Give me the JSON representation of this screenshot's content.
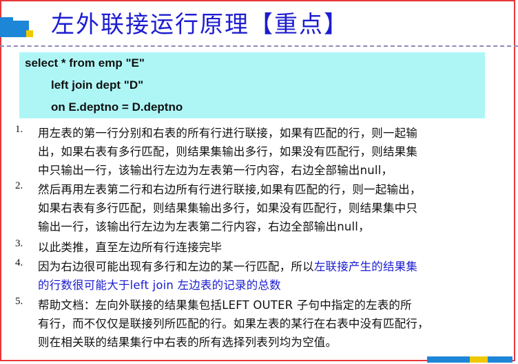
{
  "title": "左外联接运行原理【重点】",
  "code": [
    "select * from emp \"E\"",
    "left join dept \"D\"",
    "on E.deptno = D.deptno"
  ],
  "items": [
    {
      "num": "1.",
      "lines": [
        "用左表的第一行分别和右表的所有行进行联接，如果有匹配的行，则一起输",
        "出，如果右表有多行匹配，则结果集输出多行，如果没有匹配行，则结果集",
        "中只输出一行，该输出行左边为左表第一行内容，右边全部输出null，"
      ]
    },
    {
      "num": "2.",
      "lines": [
        "然后再用左表第二行和右边所有行进行联接,如果有匹配的行，则一起输出，",
        "如果右表有多行匹配，则结果集输出多行，如果没有匹配行，则结果集中只",
        "输出一行，该输出行左边为左表第二行内容，右边全部输出null，"
      ]
    },
    {
      "num": "3.",
      "lines": [
        "以此类推，直至左边所有行连接完毕"
      ]
    },
    {
      "num": "4.",
      "line1_black": "因为右边很可能出现有多行和左边的某一行匹配，所以",
      "line1_blue": "左联接产生的结果集",
      "line2_blue": "的行数很可能大于left join 左边表的记录的总数"
    },
    {
      "num": "5.",
      "lines": [
        "帮助文档：左向外联接的结果集包括LEFT OUTER 子句中指定的左表的所",
        "有行，而不仅仅是联接列所匹配的行。如果左表的某行在右表中没有匹配行，",
        "则在相关联的结果集行中右表的所有选择列表列均为空值。"
      ]
    }
  ],
  "colors": {
    "title": "#1c1cd0",
    "code_background": "#aef6f6",
    "highlight_text": "#1c1cd0",
    "frame": "#e8363a",
    "deco_blue": "#1e86d6",
    "deco_yellow": "#f0c800"
  }
}
